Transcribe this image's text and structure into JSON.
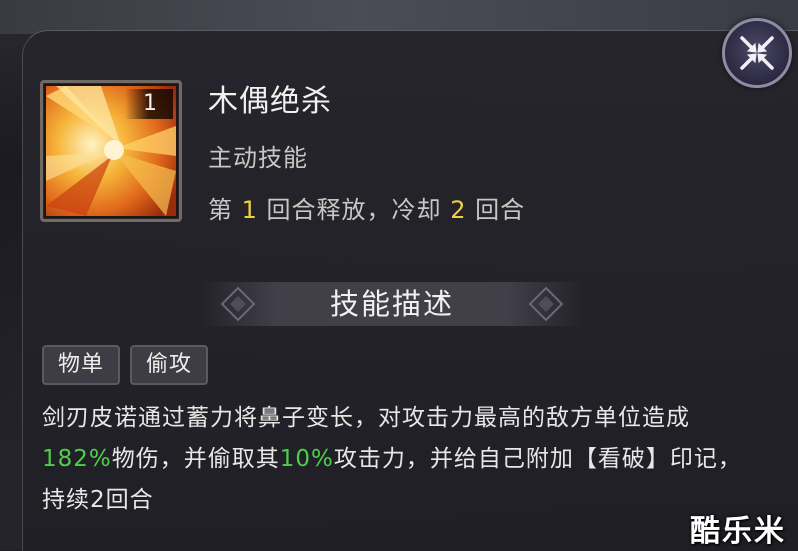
{
  "skill": {
    "name": "木偶绝杀",
    "type": "主动技能",
    "level": "1",
    "icon": "flame-burst-icon",
    "timing": {
      "prefix": "第 ",
      "release_round": "1",
      "middle": " 回合释放，冷却 ",
      "cooldown": "2",
      "suffix": " 回合"
    }
  },
  "description_section": {
    "title": "技能描述",
    "tags": [
      "物单",
      "偷攻"
    ],
    "text_parts": {
      "p1": "剑刃皮诺通过蓄力将鼻子变长，对攻击力最高的敌方单位造成",
      "damage_pct": "182%",
      "p2": "物伤，并偷取其",
      "steal_pct": "10%",
      "p3": "攻击力，并给自己附加【看破】印记，持续2回合"
    }
  },
  "close_button": {
    "icon": "close-arrows-icon"
  },
  "watermark": "酷乐米",
  "colors": {
    "accent_yellow": "#f0cf44",
    "accent_green": "#4cd04a",
    "panel_bg": "#26252c"
  }
}
